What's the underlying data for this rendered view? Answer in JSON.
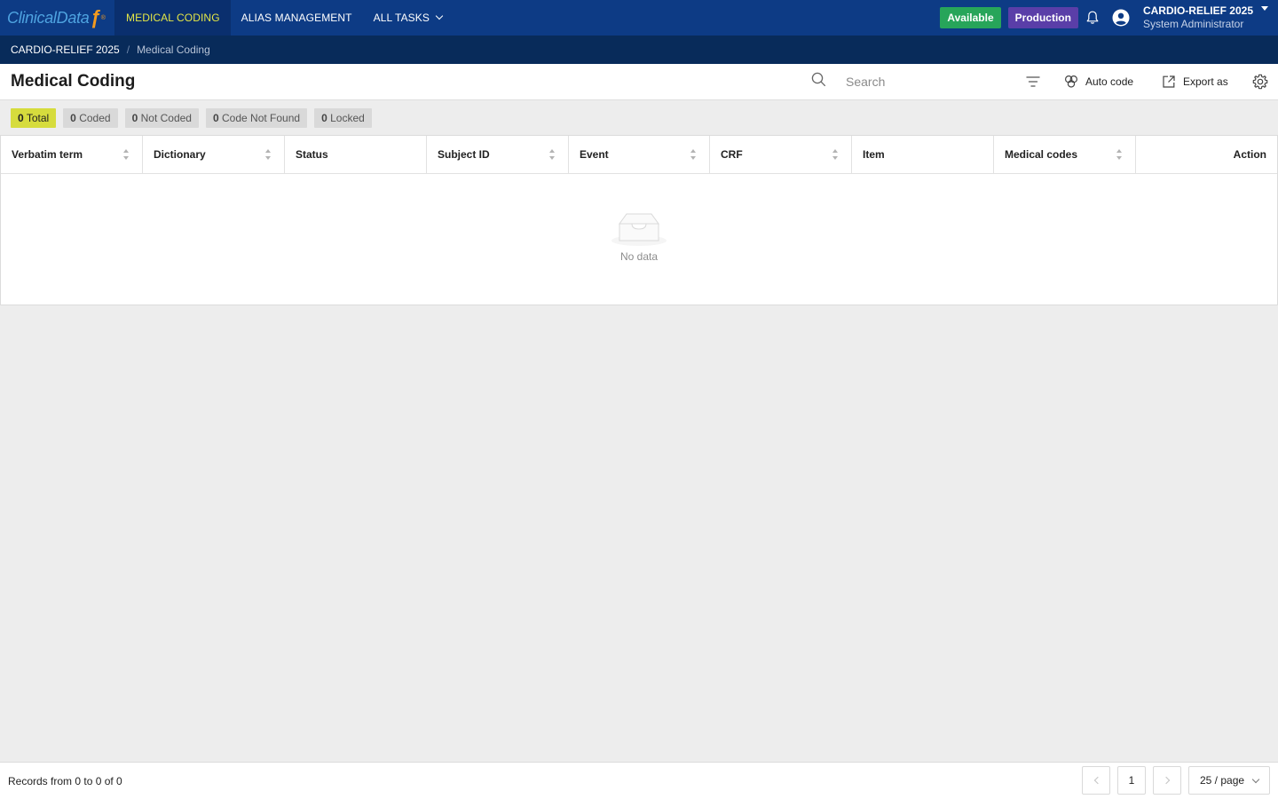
{
  "app": {
    "logo_text": "ClinicalData",
    "logo_mark": "ƒ",
    "logo_reg": "®"
  },
  "nav": {
    "items": [
      {
        "label": "MEDICAL CODING",
        "active": true
      },
      {
        "label": "ALIAS MANAGEMENT",
        "active": false
      },
      {
        "label": "ALL TASKS",
        "active": false,
        "has_dropdown": true
      }
    ],
    "status_available": "Available",
    "environment": "Production",
    "study_name": "CARDIO-RELIEF 2025",
    "user_role": "System Administrator"
  },
  "breadcrumb": {
    "study": "CARDIO-RELIEF 2025",
    "separator": "/",
    "page": "Medical Coding"
  },
  "page": {
    "title": "Medical Coding"
  },
  "toolbar": {
    "search_placeholder": "Search",
    "search_value": "",
    "auto_code_label": "Auto code",
    "export_label": "Export as"
  },
  "chips": [
    {
      "count": "0",
      "label": "Total",
      "active": true
    },
    {
      "count": "0",
      "label": "Coded",
      "active": false
    },
    {
      "count": "0",
      "label": "Not Coded",
      "active": false
    },
    {
      "count": "0",
      "label": "Code Not Found",
      "active": false
    },
    {
      "count": "0",
      "label": "Locked",
      "active": false
    }
  ],
  "table": {
    "columns": [
      {
        "label": "Verbatim term",
        "sortable": true
      },
      {
        "label": "Dictionary",
        "sortable": true
      },
      {
        "label": "Status",
        "sortable": false
      },
      {
        "label": "Subject ID",
        "sortable": true
      },
      {
        "label": "Event",
        "sortable": true
      },
      {
        "label": "CRF",
        "sortable": true
      },
      {
        "label": "Item",
        "sortable": false
      },
      {
        "label": "Medical codes",
        "sortable": true
      },
      {
        "label": "Action",
        "sortable": false
      }
    ],
    "rows": [],
    "empty_text": "No data"
  },
  "footer": {
    "records_text": "Records from 0 to 0 of 0",
    "current_page": "1",
    "page_size": "25 / page"
  },
  "colors": {
    "nav_bg": "#0d3b85",
    "nav_active_text": "#e4e646",
    "available": "#27a55a",
    "production": "#5a3ea8",
    "chip_active": "#d6dc3d"
  }
}
